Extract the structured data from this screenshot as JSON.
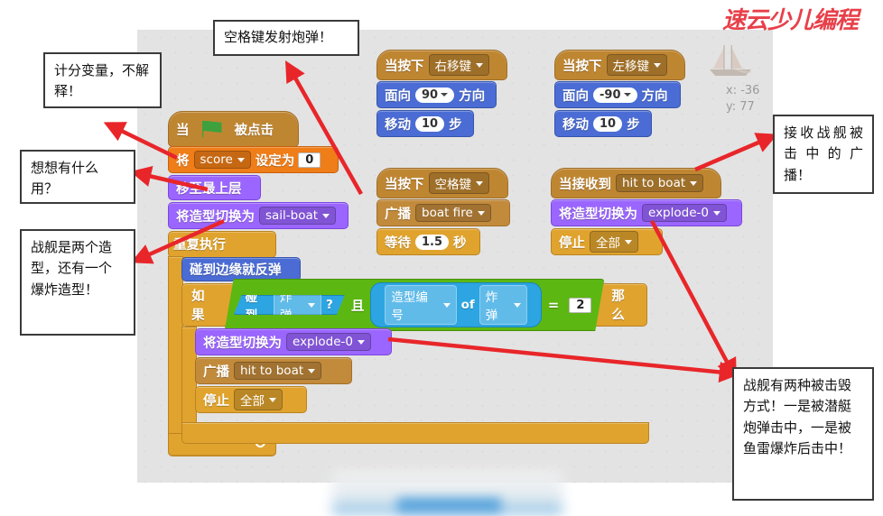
{
  "logo": {
    "text": "速云少儿编程"
  },
  "sprite": {
    "name": "sail-boat-thumbnail",
    "x_label": "x: -36",
    "y_label": "y: 77"
  },
  "callouts": [
    {
      "id": "score-var",
      "text": "计分变量，不解释！"
    },
    {
      "id": "space-fire",
      "text": "空格键发射炮弹！"
    },
    {
      "id": "what-use",
      "text": "想想有什么用？"
    },
    {
      "id": "two-costumes",
      "text": "战舰是两个造型，还有一个爆炸造型！"
    },
    {
      "id": "receive-broadcast",
      "text": "接收战舰被击中的广播！"
    },
    {
      "id": "two-destroy",
      "text": "战舰有两种被击毁方式！一是被潜艇炮弹击中，一是被鱼雷爆炸后击中！"
    }
  ],
  "scripts": {
    "main": {
      "hat": {
        "when": "当",
        "clicked": "被点击"
      },
      "set_var": {
        "verb": "将",
        "variable": "score",
        "to": "设定为",
        "value": "0"
      },
      "go_front": {
        "label": "移至最上层"
      },
      "switch_costume": {
        "label": "将造型切换为",
        "costume": "sail-boat"
      },
      "forever": {
        "label": "重复执行"
      },
      "bounce": {
        "label": "碰到边缘就反弹"
      },
      "if_block": {
        "if": "如果",
        "touching": "碰到",
        "touching_target": "炸弹",
        "qmark": "?",
        "and": "且",
        "costume_attr": "造型编号",
        "of": "of",
        "of_target": "炸弹",
        "equals": "=",
        "compare_value": "2",
        "then": "那么"
      },
      "if_body": {
        "switch_costume_label": "将造型切换为",
        "switch_costume_value": "explode-0",
        "broadcast_label": "广播",
        "broadcast_value": "hit to boat",
        "stop_label": "停止",
        "stop_value": "全部"
      }
    },
    "right_key": {
      "hat_label": "当按下",
      "key": "右移键",
      "point_label": "面向",
      "direction": "90",
      "direction_suffix": "方向",
      "move_label": "移动",
      "steps": "10",
      "steps_suffix": "步"
    },
    "left_key": {
      "hat_label": "当按下",
      "key": "左移键",
      "point_label": "面向",
      "direction": "-90",
      "direction_suffix": "方向",
      "move_label": "移动",
      "steps": "10",
      "steps_suffix": "步"
    },
    "space_key": {
      "hat_label": "当按下",
      "key": "空格键",
      "broadcast_label": "广播",
      "broadcast_value": "boat fire",
      "wait_label": "等待",
      "wait_value": "1.5",
      "wait_suffix": "秒"
    },
    "on_receive": {
      "hat_label": "当接收到",
      "message": "hit to boat",
      "switch_costume_label": "将造型切换为",
      "costume": "explode-0",
      "stop_label": "停止",
      "stop_value": "全部"
    }
  },
  "colors": {
    "events": "#c28a3b",
    "data": "#ef7d18",
    "looks": "#9b66ff",
    "motion": "#4a6cd4",
    "control": "#e0a32e",
    "sensing": "#2ca5e2",
    "operators": "#5cb712",
    "arrow": "#e8262a",
    "workspace_bg": "#e3e3e3"
  }
}
